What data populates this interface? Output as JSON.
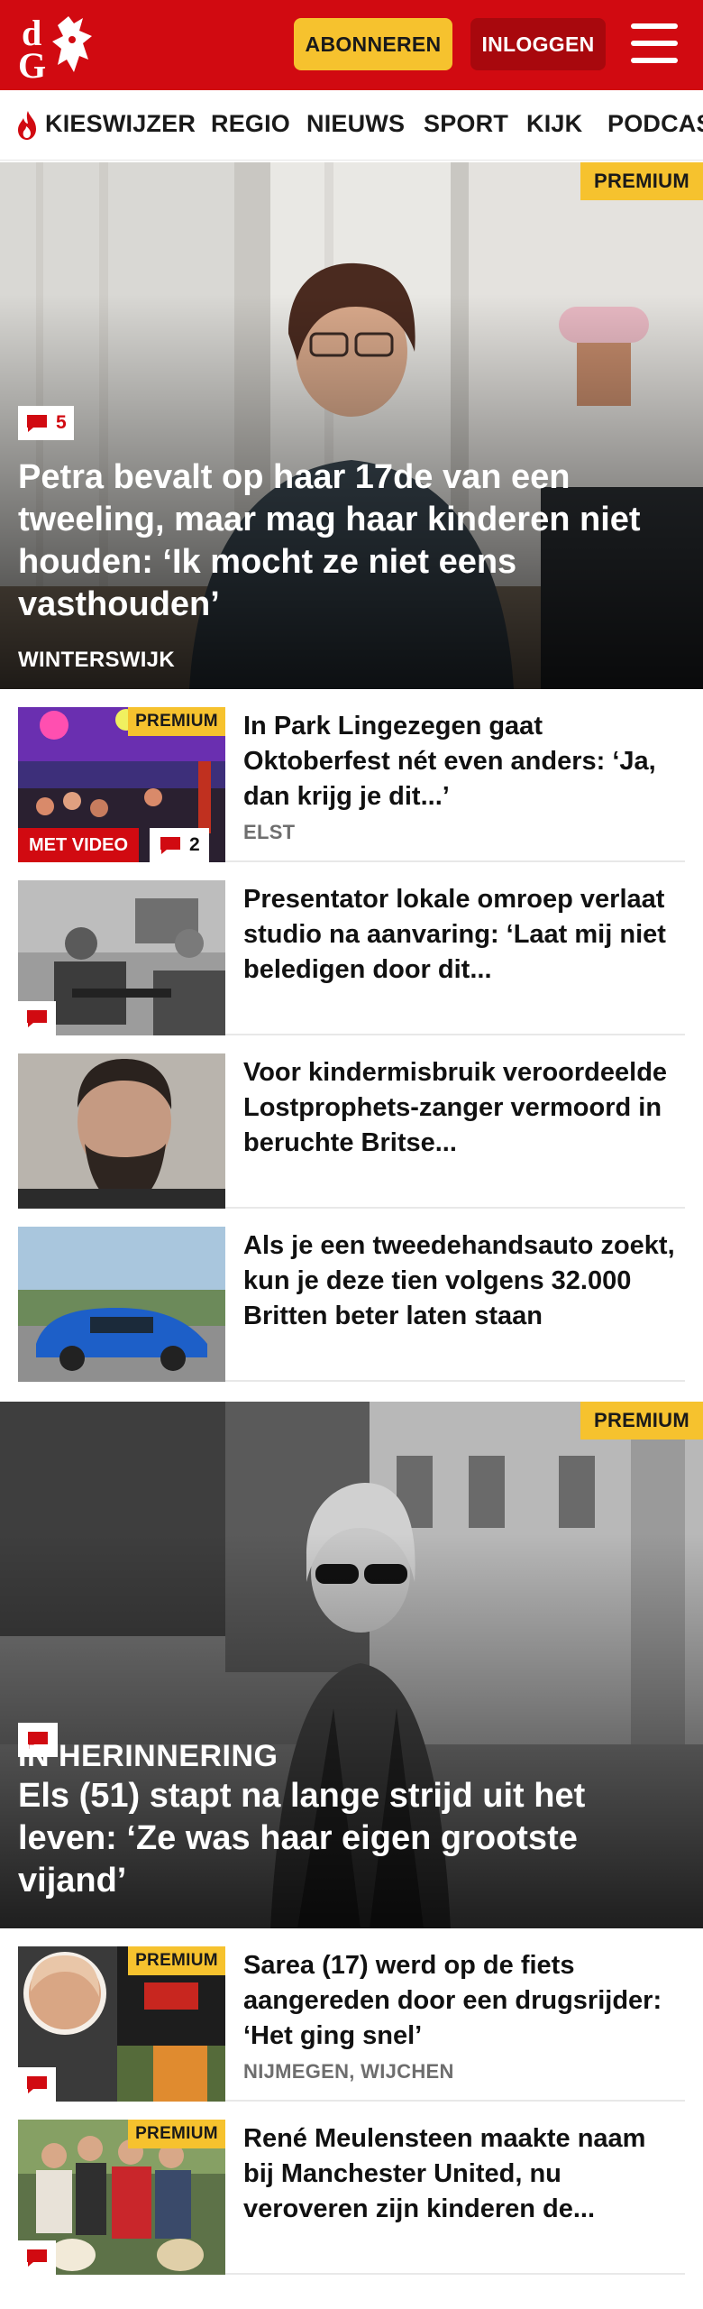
{
  "header": {
    "logo_text": "dG",
    "subscribe_label": "ABONNEREN",
    "login_label": "INLOGGEN"
  },
  "nav": {
    "items": [
      "KIESWIJZER",
      "REGIO",
      "NIEUWS",
      "SPORT",
      "KIJK",
      "PODCAS"
    ]
  },
  "colors": {
    "brand_red": "#d10a11",
    "premium_yellow": "#f6c22e",
    "login_dark_red": "#a8080d"
  },
  "icons": [
    "flame-icon",
    "hamburger-menu-icon",
    "comment-bubble-icon"
  ],
  "hero1": {
    "premium_label": "PREMIUM",
    "comment_count": "5",
    "title": "Petra bevalt op haar 17de van een tweeling, maar mag haar kinderen niet houden: ‘Ik mocht ze niet eens vasthouden’",
    "location": "WINTERSWIJK"
  },
  "articles_a": [
    {
      "premium_label": "PREMIUM",
      "video_label": "MET VIDEO",
      "comment_count": "2",
      "title": "In Park Lingezegen gaat Oktoberfest nét even anders: ‘Ja, dan krijg je dit...’",
      "location": "ELST"
    },
    {
      "title": "Presentator lokale omroep verlaat studio na aanvaring: ‘Laat mij niet beledigen door dit..."
    },
    {
      "title": "Voor kindermisbruik veroordeelde Lostprophets-zanger vermoord in beruchte Britse..."
    },
    {
      "title": "Als je een tweedehandsauto zoekt, kun je deze tien volgens 32.000 Britten beter laten staan"
    }
  ],
  "hero2": {
    "premium_label": "PREMIUM",
    "kicker": "IN HERINNERING",
    "title": "Els (51) stapt na lange strijd uit het leven: ‘Ze was haar eigen grootste vijand’"
  },
  "articles_b": [
    {
      "premium_label": "PREMIUM",
      "title": "Sarea (17) werd op de fiets aangereden door een drugsrijder: ‘Het ging snel’",
      "location": "NIJMEGEN, WIJCHEN"
    },
    {
      "premium_label": "PREMIUM",
      "title": "René Meulensteen maakte naam bij Manchester United, nu veroveren zijn kinderen de..."
    }
  ]
}
